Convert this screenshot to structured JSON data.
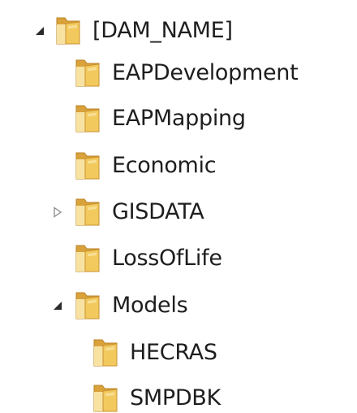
{
  "tree": {
    "nodes": [
      {
        "label": "[DAM_NAME]",
        "level": 0,
        "expander": "expanded"
      },
      {
        "label": "EAPDevelopment",
        "level": 1,
        "expander": "none"
      },
      {
        "label": "EAPMapping",
        "level": 1,
        "expander": "none"
      },
      {
        "label": "Economic",
        "level": 1,
        "expander": "none"
      },
      {
        "label": "GISDATA",
        "level": 1,
        "expander": "collapsed"
      },
      {
        "label": "LossOfLife",
        "level": 1,
        "expander": "none"
      },
      {
        "label": "Models",
        "level": 1,
        "expander": "expanded"
      },
      {
        "label": "HECRAS",
        "level": 2,
        "expander": "none"
      },
      {
        "label": "SMPDBK",
        "level": 2,
        "expander": "none"
      }
    ],
    "icon": "folder-icon",
    "colors": {
      "folder_front": "#f2c95c",
      "folder_back": "#d9a23a",
      "folder_edge": "#b98324",
      "text": "#1e1e1e",
      "arrow_expanded": "#2b2b2b",
      "arrow_collapsed": "#8a8a8a"
    }
  }
}
